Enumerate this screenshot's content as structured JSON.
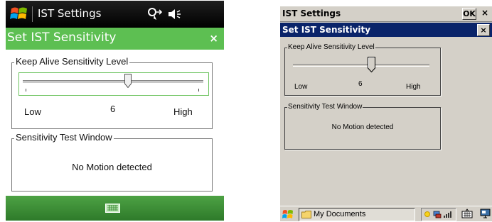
{
  "mobile": {
    "title_bar": {
      "app_title": "IST Settings"
    },
    "header": {
      "title": "Set IST Sensitivity",
      "close_label": "×"
    },
    "keep_alive": {
      "group_label": "Keep Alive Sensitivity Level",
      "low_label": "Low",
      "value_label": "6",
      "high_label": "High",
      "slider_level": 0.6
    },
    "test_window": {
      "group_label": "Sensitivity Test Window",
      "status": "No Motion detected"
    },
    "colors": {
      "header_bg": "#5dbf52",
      "bottom_bar": "#3c8f35",
      "title_bar": "#000000"
    }
  },
  "ce": {
    "title_bar": {
      "app_title": "IST Settings",
      "ok_label": "OK",
      "close_label": "×"
    },
    "header": {
      "title": "Set IST Sensitivity",
      "close_label": "×"
    },
    "keep_alive": {
      "group_label": "Keep Alive Sensitivity Level",
      "low_label": "Low",
      "value_label": "6",
      "high_label": "High",
      "slider_level": 0.6
    },
    "test_window": {
      "group_label": "Sensitivity Test Window",
      "status": "No Motion detected"
    },
    "taskbar": {
      "task_label": "My Documents"
    },
    "colors": {
      "header_bg": "#0a246a",
      "face": "#d4d0c8"
    }
  }
}
